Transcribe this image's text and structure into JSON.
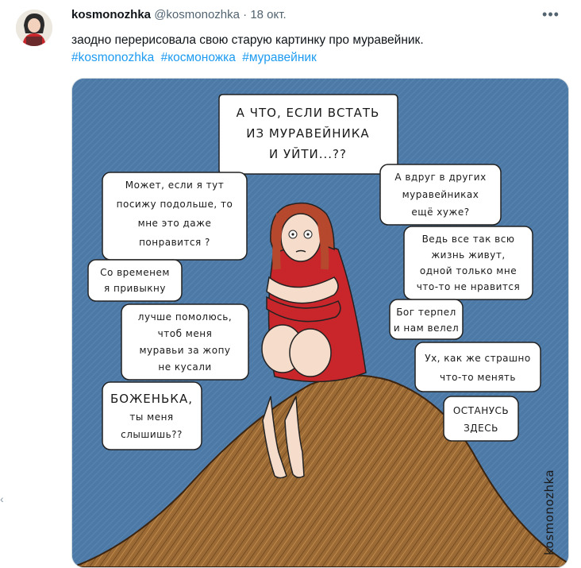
{
  "tweet": {
    "author_name": "kosmonozhka",
    "author_handle": "@kosmonozhka",
    "separator": "·",
    "date": "18 окт.",
    "text": "заодно перерисовала свою старую картинку про муравейник.",
    "hashtags": [
      "#kosmonozhka",
      "#космоножка",
      "#муравейник"
    ],
    "more_icon": "ellipsis-icon"
  },
  "comic": {
    "bubbles": {
      "top": [
        "А ЧТО, ЕСЛИ ВСТАТЬ",
        "ИЗ МУРАВЕЙНИКА",
        "И УЙТИ...??"
      ],
      "left1": [
        "Может, если я тут",
        "посижу подольше, то",
        "мне это даже",
        "понравится ?"
      ],
      "left2": [
        "Со временем",
        "я привыкну"
      ],
      "left3": [
        "лучше помолюсь,",
        "чтоб меня",
        "муравьи за жопу",
        "не кусали"
      ],
      "left4": [
        "БОЖЕНЬКА,",
        "ты меня",
        "слышишь??"
      ],
      "right1": [
        "А вдруг в других",
        "муравейниках",
        "ещё хуже?"
      ],
      "right2": [
        "Ведь все так всю",
        "жизнь живут,",
        "одной только мне",
        "что-то не нравится"
      ],
      "right3": [
        "Бог терпел",
        "и нам велел"
      ],
      "right4": [
        "Ух, как же страшно",
        "что-то менять"
      ],
      "right5": [
        "ОСТАНУСЬ",
        "ЗДЕСЬ"
      ]
    },
    "signature": "kosmonozhka",
    "colors": {
      "sky": "#4d79a6",
      "dress": "#c8262b",
      "hair": "#b5482d",
      "hill": "#9c6a34"
    }
  },
  "edge_marker": "‹"
}
